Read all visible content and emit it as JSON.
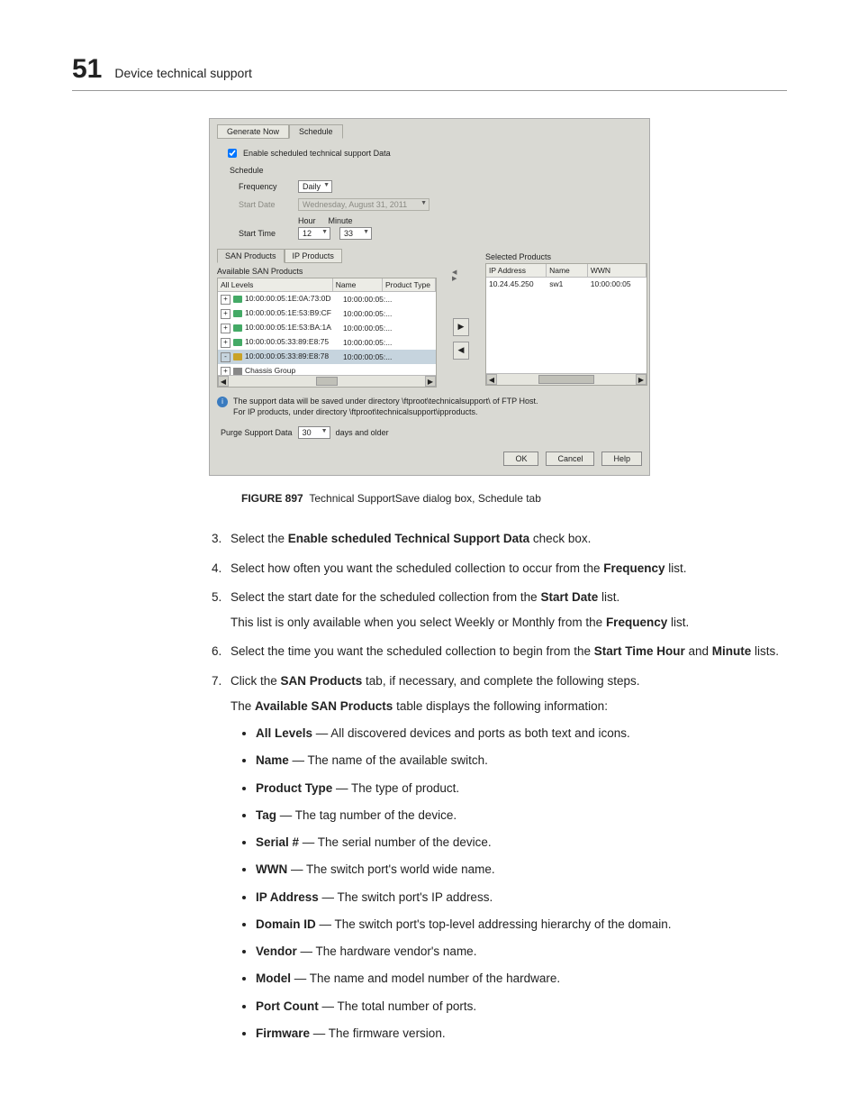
{
  "header": {
    "chapter_number": "51",
    "chapter_title": "Device technical support"
  },
  "figure": {
    "label": "FIGURE 897",
    "caption": "Technical SupportSave dialog box, Schedule tab"
  },
  "dialog": {
    "top_tabs": {
      "generate_now": "Generate Now",
      "schedule": "Schedule"
    },
    "enable_label": "Enable scheduled technical support Data",
    "schedule_heading": "Schedule",
    "labels": {
      "frequency": "Frequency",
      "start_date": "Start Date",
      "hour": "Hour",
      "minute": "Minute",
      "start_time": "Start Time"
    },
    "values": {
      "frequency": "Daily",
      "start_date": "Wednesday, August 31, 2011",
      "hour": "12",
      "minute": "33"
    },
    "inner_tabs": {
      "san": "SAN Products",
      "ip": "IP Products"
    },
    "available_title": "Available SAN Products",
    "available_headers": {
      "all_levels": "All Levels",
      "name": "Name",
      "product_type": "Product Type"
    },
    "available_rows": [
      {
        "label": "10:00:00:05:1E:0A:73:0D",
        "name": "10:00:00:05:...",
        "kind": "switch"
      },
      {
        "label": "10:00:00:05:1E:53:B9:CF",
        "name": "10:00:00:05:...",
        "kind": "switch"
      },
      {
        "label": "10:00:00:05:1E:53:BA:1A",
        "name": "10:00:00:05:...",
        "kind": "switch"
      },
      {
        "label": "10:00:00:05:33:89:E8:75",
        "name": "10:00:00:05:...",
        "kind": "switch"
      },
      {
        "label": "10:00:00:05:33:89:E8:78",
        "name": "10:00:00:05:...",
        "kind": "switch",
        "selected": true
      },
      {
        "label": "Chassis Group",
        "name": "",
        "kind": "chassis"
      }
    ],
    "selected_title": "Selected Products",
    "selected_headers": {
      "ip": "IP Address",
      "name": "Name",
      "wwn": "WWN"
    },
    "selected_rows": [
      {
        "ip": "10.24.45.250",
        "name": "sw1",
        "wwn": "10:00:00:05"
      }
    ],
    "info_line1": "The support data will be saved under directory \\ftproot\\technicalsupport\\ of FTP Host.",
    "info_line2": "For IP products, under directory \\ftproot\\technicalsupport\\ipproducts.",
    "purge_label": "Purge Support Data",
    "purge_value": "30",
    "purge_suffix": "days and older",
    "buttons": {
      "ok": "OK",
      "cancel": "Cancel",
      "help": "Help"
    },
    "shuttle": {
      "right": "▶",
      "left": "◀"
    }
  },
  "steps": {
    "s3": {
      "pre": "Select the ",
      "b": "Enable scheduled Technical Support Data",
      "post": " check box."
    },
    "s4": {
      "pre": "Select how often you want the scheduled collection to occur from the ",
      "b": "Frequency",
      "post": " list."
    },
    "s5": {
      "pre": "Select the start date for the scheduled collection from the ",
      "b": "Start Date",
      "post": " list.",
      "sub_pre": "This list is only available when you select Weekly or Monthly from the ",
      "sub_b": "Frequency",
      "sub_post": " list."
    },
    "s6": {
      "pre": "Select the time you want the scheduled collection to begin from the ",
      "b1": "Start Time Hour",
      "mid": " and ",
      "b2": "Minute",
      "post": " lists."
    },
    "s7": {
      "pre": "Click the ",
      "b": "SAN Products",
      "post": " tab, if necessary, and complete the following steps.",
      "sub_pre": "The ",
      "sub_b": "Available SAN Products",
      "sub_post": " table displays the following information:"
    }
  },
  "bullets": {
    "all_levels": {
      "b": "All Levels",
      "t": " — All discovered devices and ports as both text and icons."
    },
    "name": {
      "b": "Name",
      "t": " — The name of the available switch."
    },
    "ptype": {
      "b": "Product Type",
      "t": " — The type of product."
    },
    "tag": {
      "b": "Tag",
      "t": " — The tag number of the device."
    },
    "serial": {
      "b": "Serial #",
      "t": " — The serial number of the device."
    },
    "wwn": {
      "b": "WWN",
      "t": " — The switch port's world wide name."
    },
    "ip": {
      "b": "IP Address",
      "t": " — The switch port's IP address."
    },
    "domain": {
      "b": "Domain ID",
      "t": " — The switch port's top-level addressing hierarchy of the domain."
    },
    "vendor": {
      "b": "Vendor",
      "t": " — The hardware vendor's name."
    },
    "model": {
      "b": "Model",
      "t": " — The name and model number of the hardware."
    },
    "portcount": {
      "b": "Port Count ",
      "t": " — The total number of ports."
    },
    "firmware": {
      "b": "Firmware",
      "t": " — The firmware version."
    }
  }
}
